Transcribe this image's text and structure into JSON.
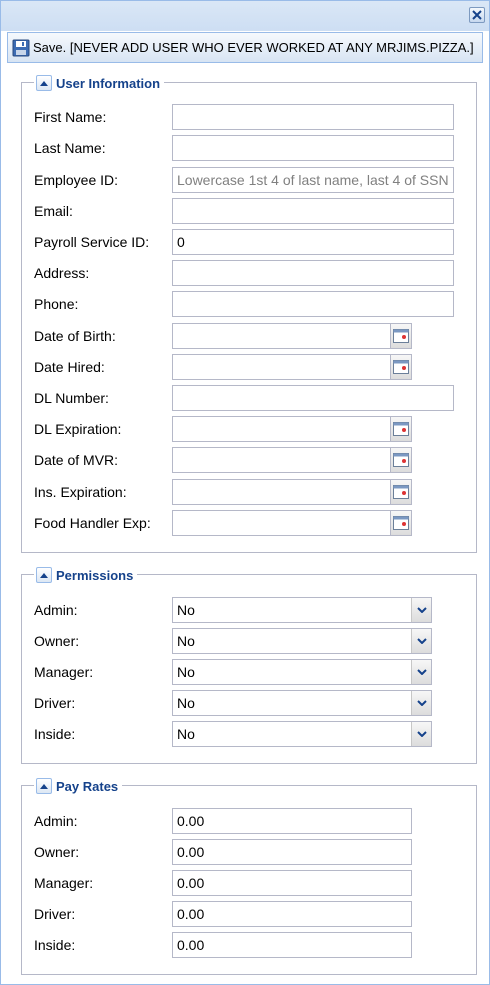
{
  "toolbar": {
    "save_label": "Save. [NEVER ADD USER WHO EVER WORKED AT ANY MRJIMS.PIZZA.]",
    "save_icon": "floppy-disk-icon"
  },
  "window": {
    "close_icon": "close-icon"
  },
  "user_info": {
    "title": "User Information",
    "first_name": {
      "label": "First Name:",
      "value": ""
    },
    "last_name": {
      "label": "Last Name:",
      "value": ""
    },
    "employee_id": {
      "label": "Employee ID:",
      "value": "",
      "placeholder": "Lowercase 1st 4 of last name, last 4 of SSN"
    },
    "email": {
      "label": "Email:",
      "value": ""
    },
    "payroll_id": {
      "label": "Payroll Service ID:",
      "value": "0"
    },
    "address": {
      "label": "Address:",
      "value": ""
    },
    "phone": {
      "label": "Phone:",
      "value": ""
    },
    "dob": {
      "label": "Date of Birth:",
      "value": ""
    },
    "date_hired": {
      "label": "Date Hired:",
      "value": ""
    },
    "dl_number": {
      "label": "DL Number:",
      "value": ""
    },
    "dl_expiration": {
      "label": "DL Expiration:",
      "value": ""
    },
    "date_mvr": {
      "label": "Date of MVR:",
      "value": ""
    },
    "ins_expiration": {
      "label": "Ins. Expiration:",
      "value": ""
    },
    "food_handler": {
      "label": "Food Handler Exp:",
      "value": ""
    }
  },
  "permissions": {
    "title": "Permissions",
    "admin": {
      "label": "Admin:",
      "value": "No"
    },
    "owner": {
      "label": "Owner:",
      "value": "No"
    },
    "manager": {
      "label": "Manager:",
      "value": "No"
    },
    "driver": {
      "label": "Driver:",
      "value": "No"
    },
    "inside": {
      "label": "Inside:",
      "value": "No"
    }
  },
  "pay_rates": {
    "title": "Pay Rates",
    "admin": {
      "label": "Admin:",
      "value": "0.00"
    },
    "owner": {
      "label": "Owner:",
      "value": "0.00"
    },
    "manager": {
      "label": "Manager:",
      "value": "0.00"
    },
    "driver": {
      "label": "Driver:",
      "value": "0.00"
    },
    "inside": {
      "label": "Inside:",
      "value": "0.00"
    }
  },
  "colors": {
    "header_text": "#15428b",
    "panel_border": "#99bbe8",
    "field_border": "#b5b8c8"
  }
}
